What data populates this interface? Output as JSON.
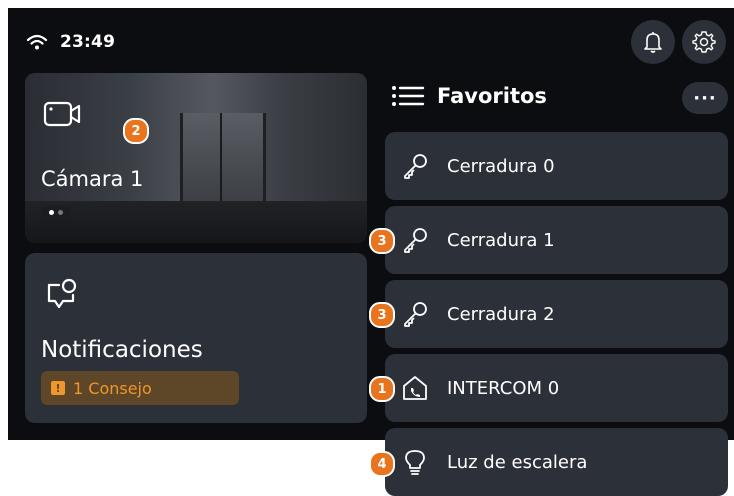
{
  "status": {
    "time": "23:49",
    "wifi_icon": "wifi-icon"
  },
  "header": {
    "bell_icon": "bell-icon",
    "settings_icon": "gear-icon"
  },
  "camera": {
    "label": "Cámara 1",
    "icon": "video-camera-icon",
    "page_count": 2,
    "active_page": 1
  },
  "notifications": {
    "label": "Notificaciones",
    "icon": "message-bell-icon",
    "badge": "1 Consejo"
  },
  "favorites": {
    "title": "Favoritos",
    "more_label": "···",
    "items": [
      {
        "label": "Cerradura 0",
        "icon": "key-icon"
      },
      {
        "label": "Cerradura 1",
        "icon": "key-icon"
      },
      {
        "label": "Cerradura 2",
        "icon": "key-icon"
      },
      {
        "label": "INTERCOM 0",
        "icon": "intercom-house-icon"
      },
      {
        "label": "Luz de escalera",
        "icon": "light-bulb-icon"
      }
    ]
  },
  "markers": [
    "2",
    "3",
    "3",
    "1",
    "4"
  ],
  "colors": {
    "background": "#0c0d10",
    "card": "#2c3038",
    "accent": "#e8741e",
    "badge_bg": "#5e4628",
    "badge_text": "#f0962a"
  }
}
